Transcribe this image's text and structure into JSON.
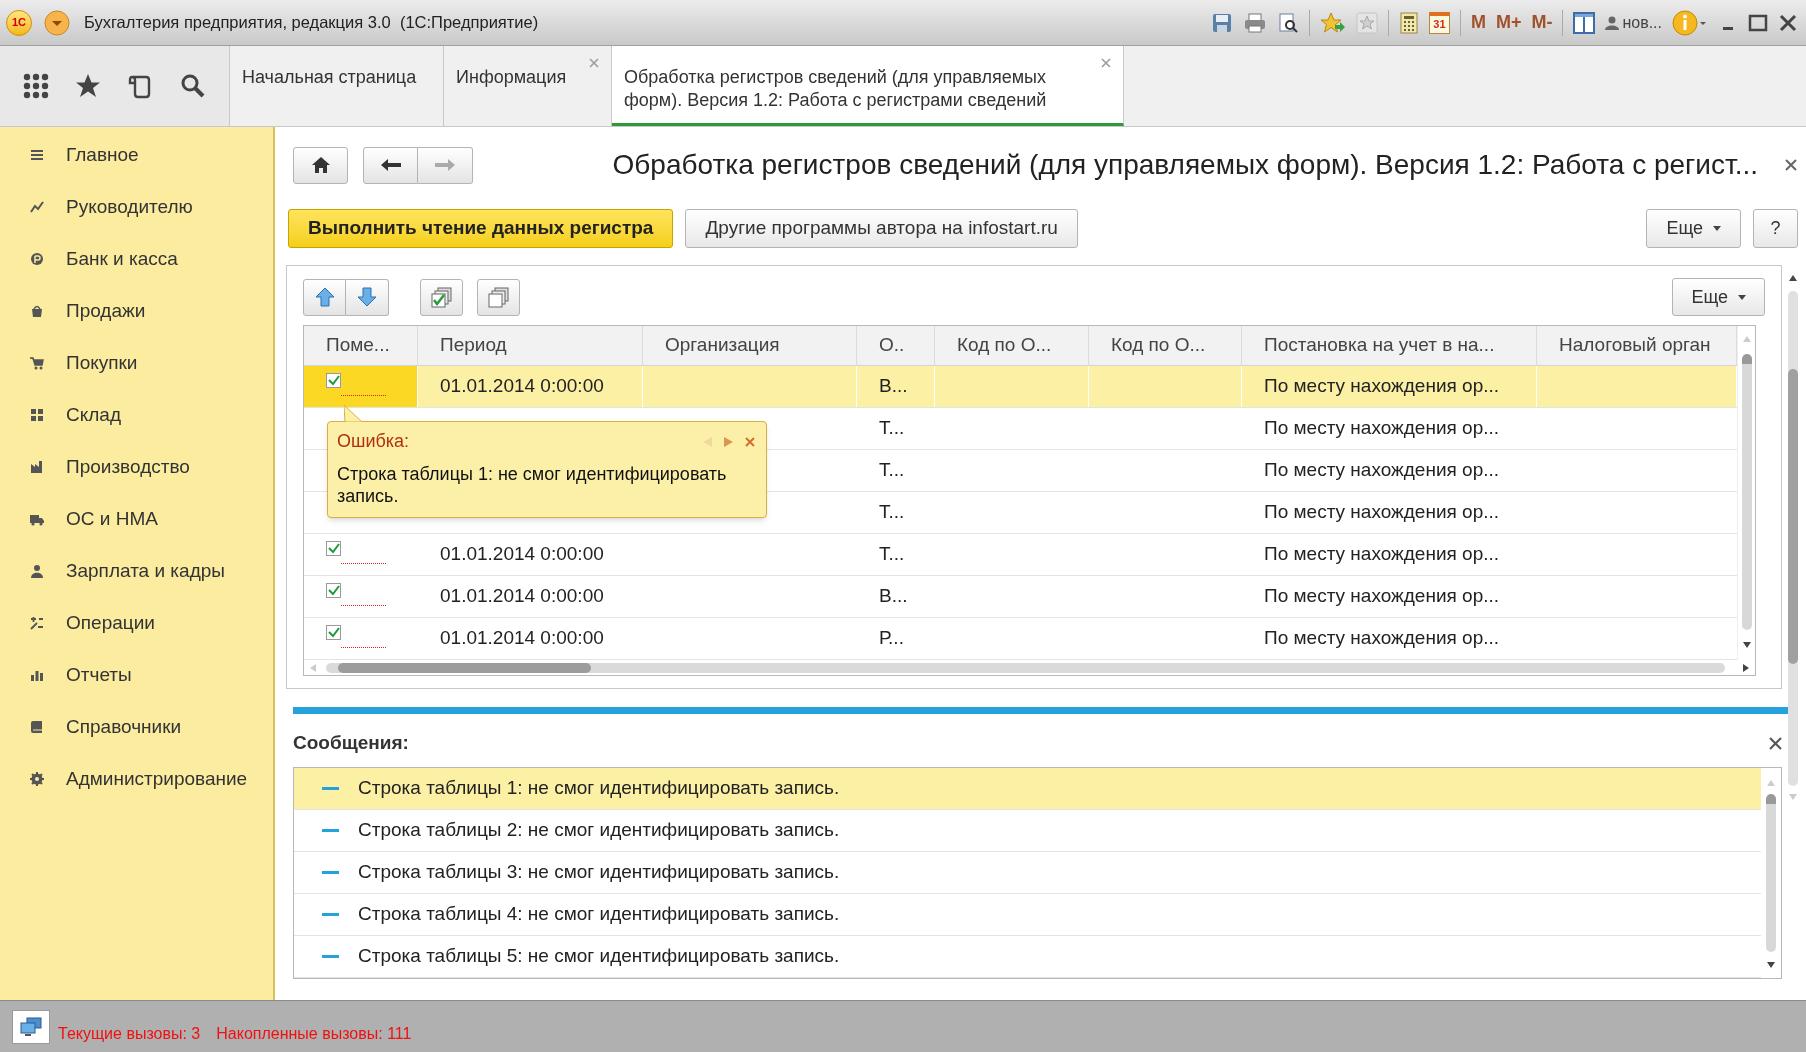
{
  "window": {
    "logo": "1С",
    "title": "Бухгалтерия предприятия, редакция 3.0  (1С:Предприятие)",
    "calendar_day": "31",
    "memory_buttons": [
      "M",
      "M+",
      "M-"
    ],
    "user": "нов..."
  },
  "tabs": [
    {
      "label": "Начальная страница",
      "selected": false,
      "closable": false
    },
    {
      "label": "Информация",
      "selected": false,
      "closable": true
    },
    {
      "label": "Обработка регистров сведений (для управляемых форм). Версия 1.2: Работа с регистрами сведений",
      "selected": true,
      "closable": true
    }
  ],
  "sidebar": {
    "items": [
      {
        "label": "Главное"
      },
      {
        "label": "Руководителю"
      },
      {
        "label": "Банк и касса"
      },
      {
        "label": "Продажи"
      },
      {
        "label": "Покупки"
      },
      {
        "label": "Склад"
      },
      {
        "label": "Производство"
      },
      {
        "label": "ОС и НМА"
      },
      {
        "label": "Зарплата и кадры"
      },
      {
        "label": "Операции"
      },
      {
        "label": "Отчеты"
      },
      {
        "label": "Справочники"
      },
      {
        "label": "Администрирование"
      }
    ]
  },
  "form": {
    "title": "Обработка регистров сведений (для управляемых форм). Версия 1.2: Работа с регист...",
    "buttons": [
      {
        "label": "Выполнить чтение данных регистра",
        "kind": "primary"
      },
      {
        "label": "Другие программы автора на infostart.ru",
        "kind": "normal"
      }
    ],
    "more": "Еще",
    "help": "?"
  },
  "table": {
    "more": "Еще",
    "columns": [
      "Поме...",
      "Период",
      "Организация",
      "О..",
      "Код по О...",
      "Код по О...",
      "Постановка на учет в на...",
      "Налоговый орган"
    ],
    "rows": [
      {
        "selected": true,
        "checked": true,
        "period": "01.01.2014 0:00:00",
        "o": "В...",
        "registration": "По месту нахождения ор..."
      },
      {
        "selected": false,
        "o": "Т...",
        "registration": "По месту нахождения ор..."
      },
      {
        "selected": false,
        "o": "Т...",
        "registration": "По месту нахождения ор..."
      },
      {
        "selected": false,
        "o": "Т...",
        "registration": "По месту нахождения ор..."
      },
      {
        "selected": false,
        "checked": true,
        "period": "01.01.2014 0:00:00",
        "o": "Т...",
        "registration": "По месту нахождения ор..."
      },
      {
        "selected": false,
        "checked": true,
        "period": "01.01.2014 0:00:00",
        "o": "В...",
        "registration": "По месту нахождения ор..."
      },
      {
        "selected": false,
        "checked": true,
        "period": "01.01.2014 0:00:00",
        "o": "Р...",
        "registration": "По месту нахождения ор..."
      }
    ]
  },
  "error_popup": {
    "title": "Ошибка:",
    "text": "Строка таблицы 1: не смог идентифицировать запись."
  },
  "messages": {
    "title": "Сообщения:",
    "items": [
      {
        "text": "Строка таблицы 1: не смог идентифицировать запись.",
        "selected": true
      },
      {
        "text": "Строка таблицы 2: не смог идентифицировать запись.",
        "selected": false
      },
      {
        "text": "Строка таблицы 3: не смог идентифицировать запись.",
        "selected": false
      },
      {
        "text": "Строка таблицы 4: не смог идентифицировать запись.",
        "selected": false
      },
      {
        "text": "Строка таблицы 5: не смог идентифицировать запись.",
        "selected": false
      }
    ]
  },
  "status_bar": {
    "current_calls": "Текущие вызовы: 3",
    "accumulated_calls": "Накопленные вызовы: 111"
  }
}
